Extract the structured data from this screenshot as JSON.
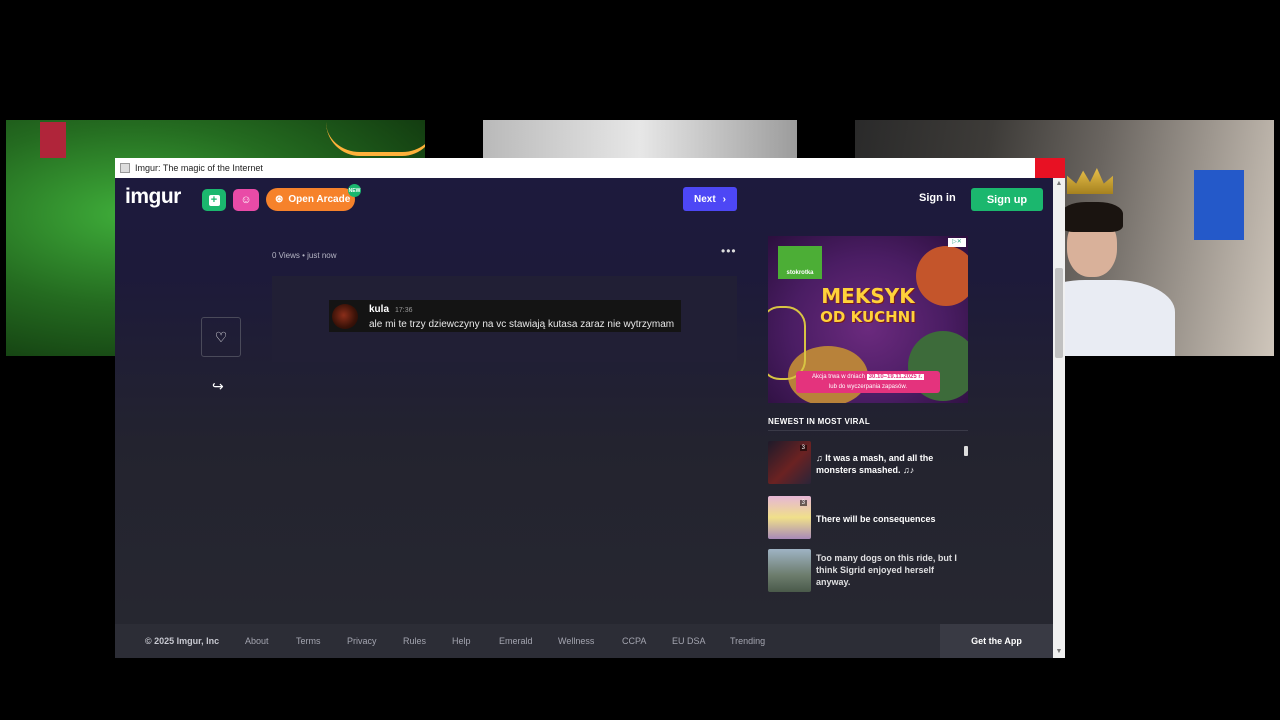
{
  "window": {
    "title": "Imgur: The magic of the Internet"
  },
  "header": {
    "logo": "imgur",
    "arcade_label": "Open Arcade",
    "arcade_badge": "NEW",
    "next_label": "Next",
    "signin_label": "Sign in",
    "signup_label": "Sign up"
  },
  "post": {
    "views": "0 Views",
    "time": "just now",
    "message": {
      "author": "kula",
      "timestamp": "17:36",
      "text": "ale mi te trzy dziewczyny na vc stawiają kutasa zaraz nie wytrzymam"
    }
  },
  "ad": {
    "brand": "stokrotka",
    "adchoices": "▷✕",
    "title_line1": "MEKSYK",
    "title_line2": "OD KUCHNI",
    "promo_line1": "Akcja trwa w dniach",
    "promo_dates": "30.10–19.11.2025 r.",
    "promo_line2": "lub do wyczerpania zapasów."
  },
  "sidebar": {
    "heading": "NEWEST IN MOST VIRAL",
    "items": [
      {
        "title": "♫ It was a mash, and all the monsters smashed. ♫♪",
        "count": "3",
        "thumb_color": "#2a2438"
      },
      {
        "title": "There will be consequences",
        "count": "3",
        "thumb_color": "#c9a9c9"
      },
      {
        "title": "Too many dogs on this ride, but I think Sigrid enjoyed herself anyway.",
        "count": "",
        "thumb_color": "#7b8a8a"
      }
    ]
  },
  "footer": {
    "copyright": "© 2025 Imgur, Inc",
    "links": [
      "About",
      "Terms",
      "Privacy",
      "Rules",
      "Help",
      "Emerald",
      "Wellness",
      "CCPA",
      "EU DSA",
      "Trending"
    ],
    "get_app": "Get the App"
  },
  "colors": {
    "upload_green": "#1bb76e",
    "emoji_pink": "#e94ba7",
    "arcade_orange": "#f6822b",
    "next_blue": "#4d47f5",
    "signup_green": "#1bb76e"
  }
}
